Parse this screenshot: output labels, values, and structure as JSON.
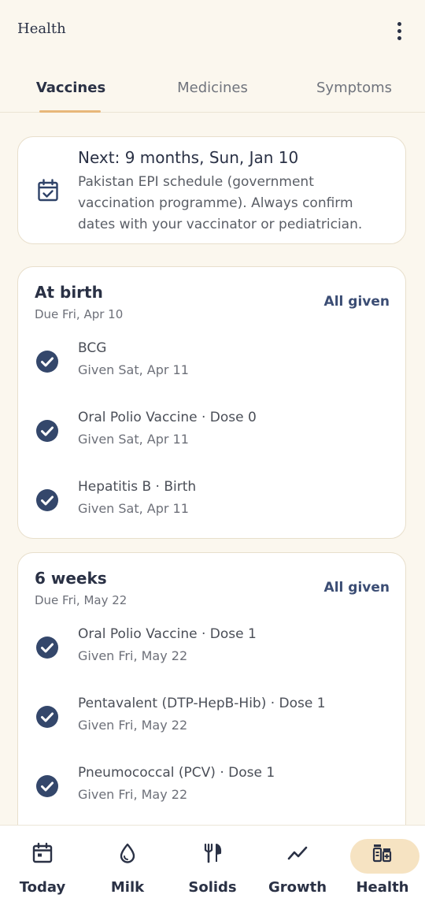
{
  "app": {
    "title": "Health"
  },
  "tabs": [
    {
      "label": "Vaccines",
      "active": true
    },
    {
      "label": "Medicines",
      "active": false
    },
    {
      "label": "Symptoms",
      "active": false
    }
  ],
  "next": {
    "title": "Next: 9 months, Sun, Jan 10",
    "description": "Pakistan EPI schedule (government vaccination programme). Always confirm dates with your vaccinator or pediatrician."
  },
  "groups": [
    {
      "title": "At birth",
      "due": "Due Fri, Apr 10",
      "status": "All given",
      "vaccines": [
        {
          "name": "BCG",
          "given": "Given Sat, Apr 11"
        },
        {
          "name": "Oral Polio Vaccine · Dose 0",
          "given": "Given Sat, Apr 11"
        },
        {
          "name": "Hepatitis B · Birth",
          "given": "Given Sat, Apr 11"
        }
      ]
    },
    {
      "title": "6 weeks",
      "due": "Due Fri, May 22",
      "status": "All given",
      "vaccines": [
        {
          "name": "Oral Polio Vaccine · Dose 1",
          "given": "Given Fri, May 22"
        },
        {
          "name": "Pentavalent (DTP-HepB-Hib) · Dose 1",
          "given": "Given Fri, May 22"
        },
        {
          "name": "Pneumococcal (PCV) · Dose 1",
          "given": "Given Fri, May 22"
        }
      ]
    }
  ],
  "nav": [
    {
      "label": "Today",
      "icon": "calendar-icon",
      "active": false
    },
    {
      "label": "Milk",
      "icon": "drop-icon",
      "active": false
    },
    {
      "label": "Solids",
      "icon": "utensils-icon",
      "active": false
    },
    {
      "label": "Growth",
      "icon": "trend-icon",
      "active": false
    },
    {
      "label": "Health",
      "icon": "vaccine-vials-icon",
      "active": true
    }
  ],
  "colors": {
    "background": "#fbf7ee",
    "accent": "#e8b77a",
    "check": "#34476b",
    "active_pill": "#f6e3c2"
  }
}
